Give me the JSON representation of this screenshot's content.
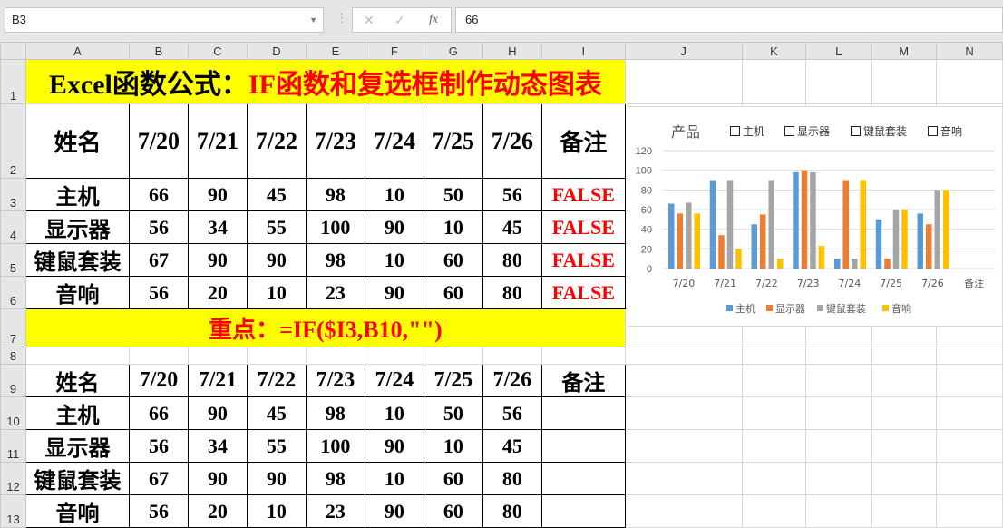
{
  "formula_bar": {
    "name_box": "B3",
    "formula": "66",
    "cancel": "✕",
    "enter": "✓",
    "fx": "fx"
  },
  "columns": [
    "A",
    "B",
    "C",
    "D",
    "E",
    "F",
    "G",
    "H",
    "I",
    "J",
    "K",
    "L",
    "M",
    "N"
  ],
  "rows": [
    "1",
    "2",
    "3",
    "4",
    "5",
    "6",
    "7",
    "8",
    "9",
    "10",
    "11",
    "12",
    "13"
  ],
  "title": {
    "black": "Excel函数公式：",
    "red": "IF函数和复选框制作动态图表"
  },
  "headers": [
    "姓名",
    "7/20",
    "7/21",
    "7/22",
    "7/23",
    "7/24",
    "7/25",
    "7/26",
    "备注"
  ],
  "table1": [
    [
      "主机",
      "66",
      "90",
      "45",
      "98",
      "10",
      "50",
      "56",
      "FALSE"
    ],
    [
      "显示器",
      "56",
      "34",
      "55",
      "100",
      "90",
      "10",
      "45",
      "FALSE"
    ],
    [
      "键鼠套装",
      "67",
      "90",
      "90",
      "98",
      "10",
      "60",
      "80",
      "FALSE"
    ],
    [
      "音响",
      "56",
      "20",
      "10",
      "23",
      "90",
      "60",
      "80",
      "FALSE"
    ]
  ],
  "key_point": {
    "label": "重点：",
    "formula": "=IF($I3,B10,\"\")"
  },
  "table2": [
    [
      "主机",
      "66",
      "90",
      "45",
      "98",
      "10",
      "50",
      "56",
      ""
    ],
    [
      "显示器",
      "56",
      "34",
      "55",
      "100",
      "90",
      "10",
      "45",
      ""
    ],
    [
      "键鼠套装",
      "67",
      "90",
      "90",
      "98",
      "10",
      "60",
      "80",
      ""
    ],
    [
      "音响",
      "56",
      "20",
      "10",
      "23",
      "90",
      "60",
      "80",
      ""
    ]
  ],
  "chart_data": {
    "type": "bar",
    "title": "产品",
    "checkboxes": [
      "主机",
      "显示器",
      "键鼠套装",
      "音响"
    ],
    "categories": [
      "7/20",
      "7/21",
      "7/22",
      "7/23",
      "7/24",
      "7/25",
      "7/26",
      "备注"
    ],
    "ylim": [
      0,
      120
    ],
    "yticks": [
      "0",
      "20",
      "40",
      "60",
      "80",
      "100",
      "120"
    ],
    "legend_position": "bottom",
    "series": [
      {
        "name": "主机",
        "color": "#5b9bd5",
        "values": [
          66,
          90,
          45,
          98,
          10,
          50,
          56,
          null
        ]
      },
      {
        "name": "显示器",
        "color": "#ed7d31",
        "values": [
          56,
          34,
          55,
          100,
          90,
          10,
          45,
          null
        ]
      },
      {
        "name": "键鼠套装",
        "color": "#a5a5a5",
        "values": [
          67,
          90,
          90,
          98,
          10,
          60,
          80,
          null
        ]
      },
      {
        "name": "音响",
        "color": "#ffc000",
        "values": [
          56,
          20,
          10,
          23,
          90,
          60,
          80,
          null
        ]
      }
    ]
  }
}
